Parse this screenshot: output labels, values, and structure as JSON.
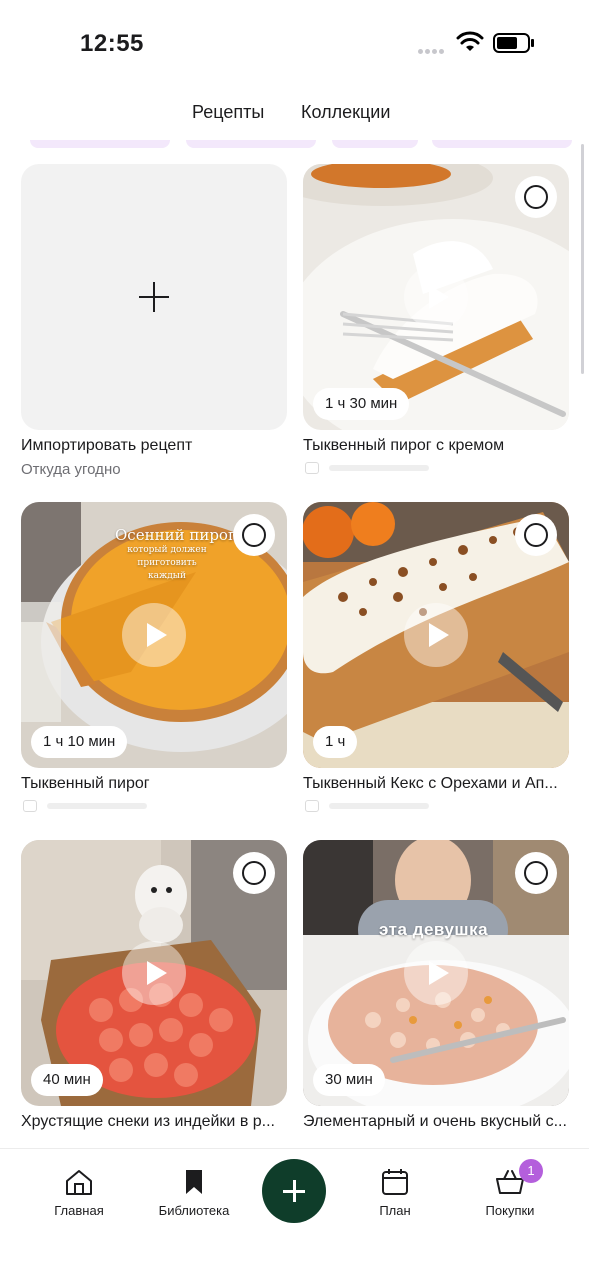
{
  "status_bar": {
    "time": "12:55"
  },
  "tabs": [
    {
      "label": "Рецепты",
      "active": true
    },
    {
      "label": "Коллекции",
      "active": false
    }
  ],
  "import_card": {
    "title": "Импортировать рецепт",
    "subtitle": "Откуда угодно",
    "icon": "plus-icon"
  },
  "recipes": [
    {
      "title": "Тыквенный пирог с кремом",
      "time": "1 ч 30 мин"
    },
    {
      "title": "Тыквенный пирог",
      "time": "1 ч 10 мин",
      "overlay_title": "Осенний пирог",
      "overlay_sub": "который должен приготовить каждый"
    },
    {
      "title": "Тыквенный Кекс с Орехами и Ап...",
      "time": "1 ч"
    },
    {
      "title": "Хрустящие снеки из индейки в р...",
      "time": "40 мин"
    },
    {
      "title": "Элементарный и очень вкусный с...",
      "time": "30 мин",
      "overlay_title": "эта девушка"
    }
  ],
  "bottom_nav": {
    "home": "Главная",
    "library": "Библиотека",
    "plan": "План",
    "shopping": "Покупки",
    "shopping_badge": "1"
  },
  "colors": {
    "accent": "#0f3d2a",
    "badge": "#b45fdc",
    "chip": "#f3e8fb",
    "placeholder_bg": "#f2f2f2"
  }
}
